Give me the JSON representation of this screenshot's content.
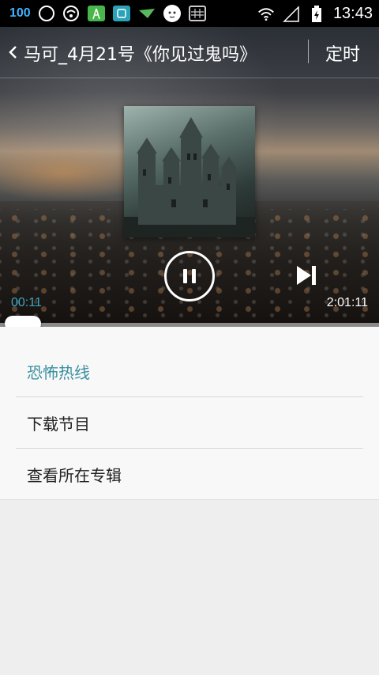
{
  "status_bar": {
    "battery_percent": "100",
    "time": "13:43",
    "icons": [
      "weibo-icon",
      "wifi-icon",
      "signal-tower-icon",
      "ting-app-icon",
      "paper-plane-icon",
      "cat-face-icon",
      "keyboard-icon",
      "wifi-signal-icon",
      "cell-signal-icon",
      "battery-charging-icon"
    ]
  },
  "header": {
    "title": "马可_4月21号《你见过鬼吗》",
    "timer_label": "定时"
  },
  "player": {
    "elapsed": "00:11",
    "duration": "2:01:11",
    "progress_fraction": 0.001,
    "state": "playing"
  },
  "menu": {
    "items": [
      {
        "label": "恐怖热线",
        "active": true
      },
      {
        "label": "下载节目",
        "active": false
      },
      {
        "label": "查看所在专辑",
        "active": false
      }
    ]
  },
  "colors": {
    "accent": "#3a8fa0",
    "elapsed_color": "#3aa7c0"
  }
}
